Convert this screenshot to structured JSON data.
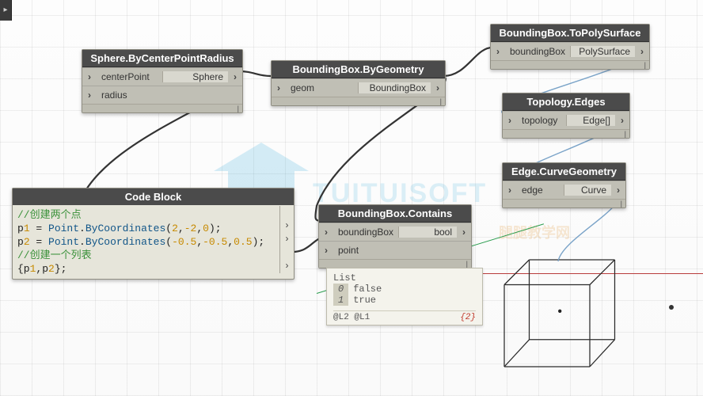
{
  "watermark": {
    "brand": "TUITUISOFT",
    "tag": "腿腿教学网"
  },
  "nodes": {
    "sphere": {
      "title": "Sphere.ByCenterPointRadius",
      "in": [
        "centerPoint",
        "radius"
      ],
      "out": "Sphere"
    },
    "bbgeom": {
      "title": "BoundingBox.ByGeometry",
      "in": [
        "geom"
      ],
      "out": "BoundingBox"
    },
    "bbpoly": {
      "title": "BoundingBox.ToPolySurface",
      "in": [
        "boundingBox"
      ],
      "out": "PolySurface"
    },
    "topoEdges": {
      "title": "Topology.Edges",
      "in": [
        "topology"
      ],
      "out": "Edge[]"
    },
    "edgeCurve": {
      "title": "Edge.CurveGeometry",
      "in": [
        "edge"
      ],
      "out": "Curve"
    },
    "bbcontains": {
      "title": "BoundingBox.Contains",
      "in": [
        "boundingBox",
        "point"
      ],
      "out": "bool"
    },
    "codeblock": {
      "title": "Code Block",
      "lines": [
        {
          "kind": "comment",
          "text": "//创建两个点"
        },
        {
          "kind": "stmt",
          "raw": "p1 = Point.ByCoordinates(2,-2,0);"
        },
        {
          "kind": "stmt",
          "raw": "p2 = Point.ByCoordinates(-0.5,-0.5,0.5);"
        },
        {
          "kind": "comment",
          "text": "//创建一个列表"
        },
        {
          "kind": "stmt",
          "raw": "{p1,p2};"
        }
      ]
    }
  },
  "preview": {
    "header": "List",
    "items": [
      {
        "idx": "0",
        "val": "false"
      },
      {
        "idx": "1",
        "val": "true"
      }
    ],
    "levels": "@L2 @L1",
    "count": "{2}"
  }
}
